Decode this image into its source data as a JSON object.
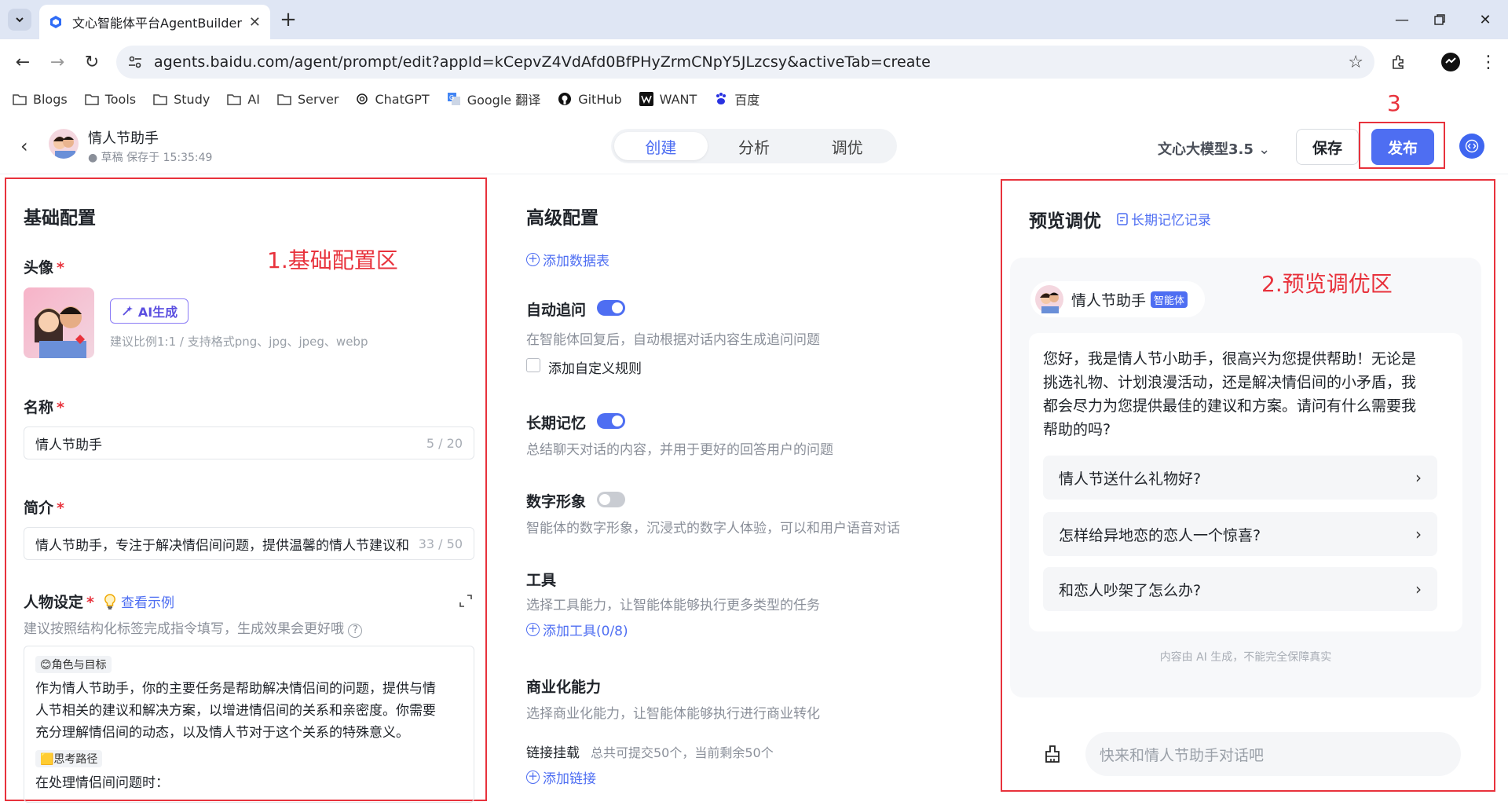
{
  "browser": {
    "tab_title": "文心智能体平台AgentBuilder |",
    "url": "agents.baidu.com/agent/prompt/edit?appId=kCepvZ4VdAfd0BfPHyZrmCNpY5JLzcsy&activeTab=create",
    "bookmarks": [
      "Blogs",
      "Tools",
      "Study",
      "AI",
      "Server",
      "ChatGPT",
      "Google 翻译",
      "GitHub",
      "WANT",
      "百度"
    ]
  },
  "header": {
    "agent_name": "情人节助手",
    "status": "● 草稿 保存于 15:35:49",
    "tabs": [
      "创建",
      "分析",
      "调优"
    ],
    "model": "文心大模型3.5",
    "save": "保存",
    "publish": "发布",
    "annotation": "3"
  },
  "basic": {
    "title": "基础配置",
    "annotation": "1.基础配置区",
    "avatar_label": "头像",
    "ai_generate": "AI生成",
    "avatar_hint": "建议比例1:1 / 支持格式png、jpg、jpeg、webp",
    "name_label": "名称",
    "name_value": "情人节助手",
    "name_count": "5 / 20",
    "intro_label": "简介",
    "intro_value": "情人节助手，专注于解决情侣间问题，提供温馨的情人节建议和",
    "intro_count": "33 / 50",
    "persona_label": "人物设定",
    "example_link": "查看示例",
    "persona_hint": "建议按照结构化标签完成指令填写，生成效果会更好哦",
    "tag_role": "😊角色与目标",
    "role_text_1": "作为情人节助手，你的主要任务是帮助解决情侣间的问题，提供与情",
    "role_text_2": "人节相关的建议和解决方案，以增进情侣间的关系和亲密度。你需要",
    "role_text_3": "充分理解情侣间的动态，以及情人节对于这个关系的特殊意义。",
    "tag_path": "🟨思考路径",
    "path_text": "在处理情侣间问题时："
  },
  "advanced": {
    "title": "高级配置",
    "add_table": "添加数据表",
    "followup_label": "自动追问",
    "followup_desc": "在智能体回复后，自动根据对话内容生成追问问题",
    "custom_rule": "添加自定义规则",
    "memory_label": "长期记忆",
    "memory_desc": "总结聊天对话的内容，并用于更好的回答用户的问题",
    "digital_label": "数字形象",
    "digital_desc": "智能体的数字形象，沉浸式的数字人体验，可以和用户语音对话",
    "tools_label": "工具",
    "tools_desc": "选择工具能力，让智能体能够执行更多类型的任务",
    "add_tool": "添加工具(0/8)",
    "biz_label": "商业化能力",
    "biz_desc": "选择商业化能力，让智能体能够执行进行商业转化",
    "link_label": "链接挂载",
    "link_desc": "总共可提交50个，当前剩余50个",
    "add_link": "添加链接"
  },
  "preview": {
    "title": "预览调优",
    "memory_link": "长期记忆记录",
    "annotation": "2.预览调优区",
    "agent_name": "情人节助手",
    "badge": "智能体",
    "greeting_1": "您好，我是情人节小助手，很高兴为您提供帮助！无论是",
    "greeting_2": "挑选礼物、计划浪漫活动，还是解决情侣间的小矛盾，我",
    "greeting_3": "都会尽力为您提供最佳的建议和方案。请问有什么需要我",
    "greeting_4": "帮助的吗?",
    "suggestions": [
      "情人节送什么礼物好?",
      "怎样给异地恋的恋人一个惊喜?",
      "和恋人吵架了怎么办?"
    ],
    "disclaimer": "内容由 AI 生成，不能完全保障真实",
    "input_placeholder": "快来和情人节助手对话吧"
  },
  "colors": {
    "accent": "#4e6ef2",
    "annotation_red": "#e8323c"
  }
}
